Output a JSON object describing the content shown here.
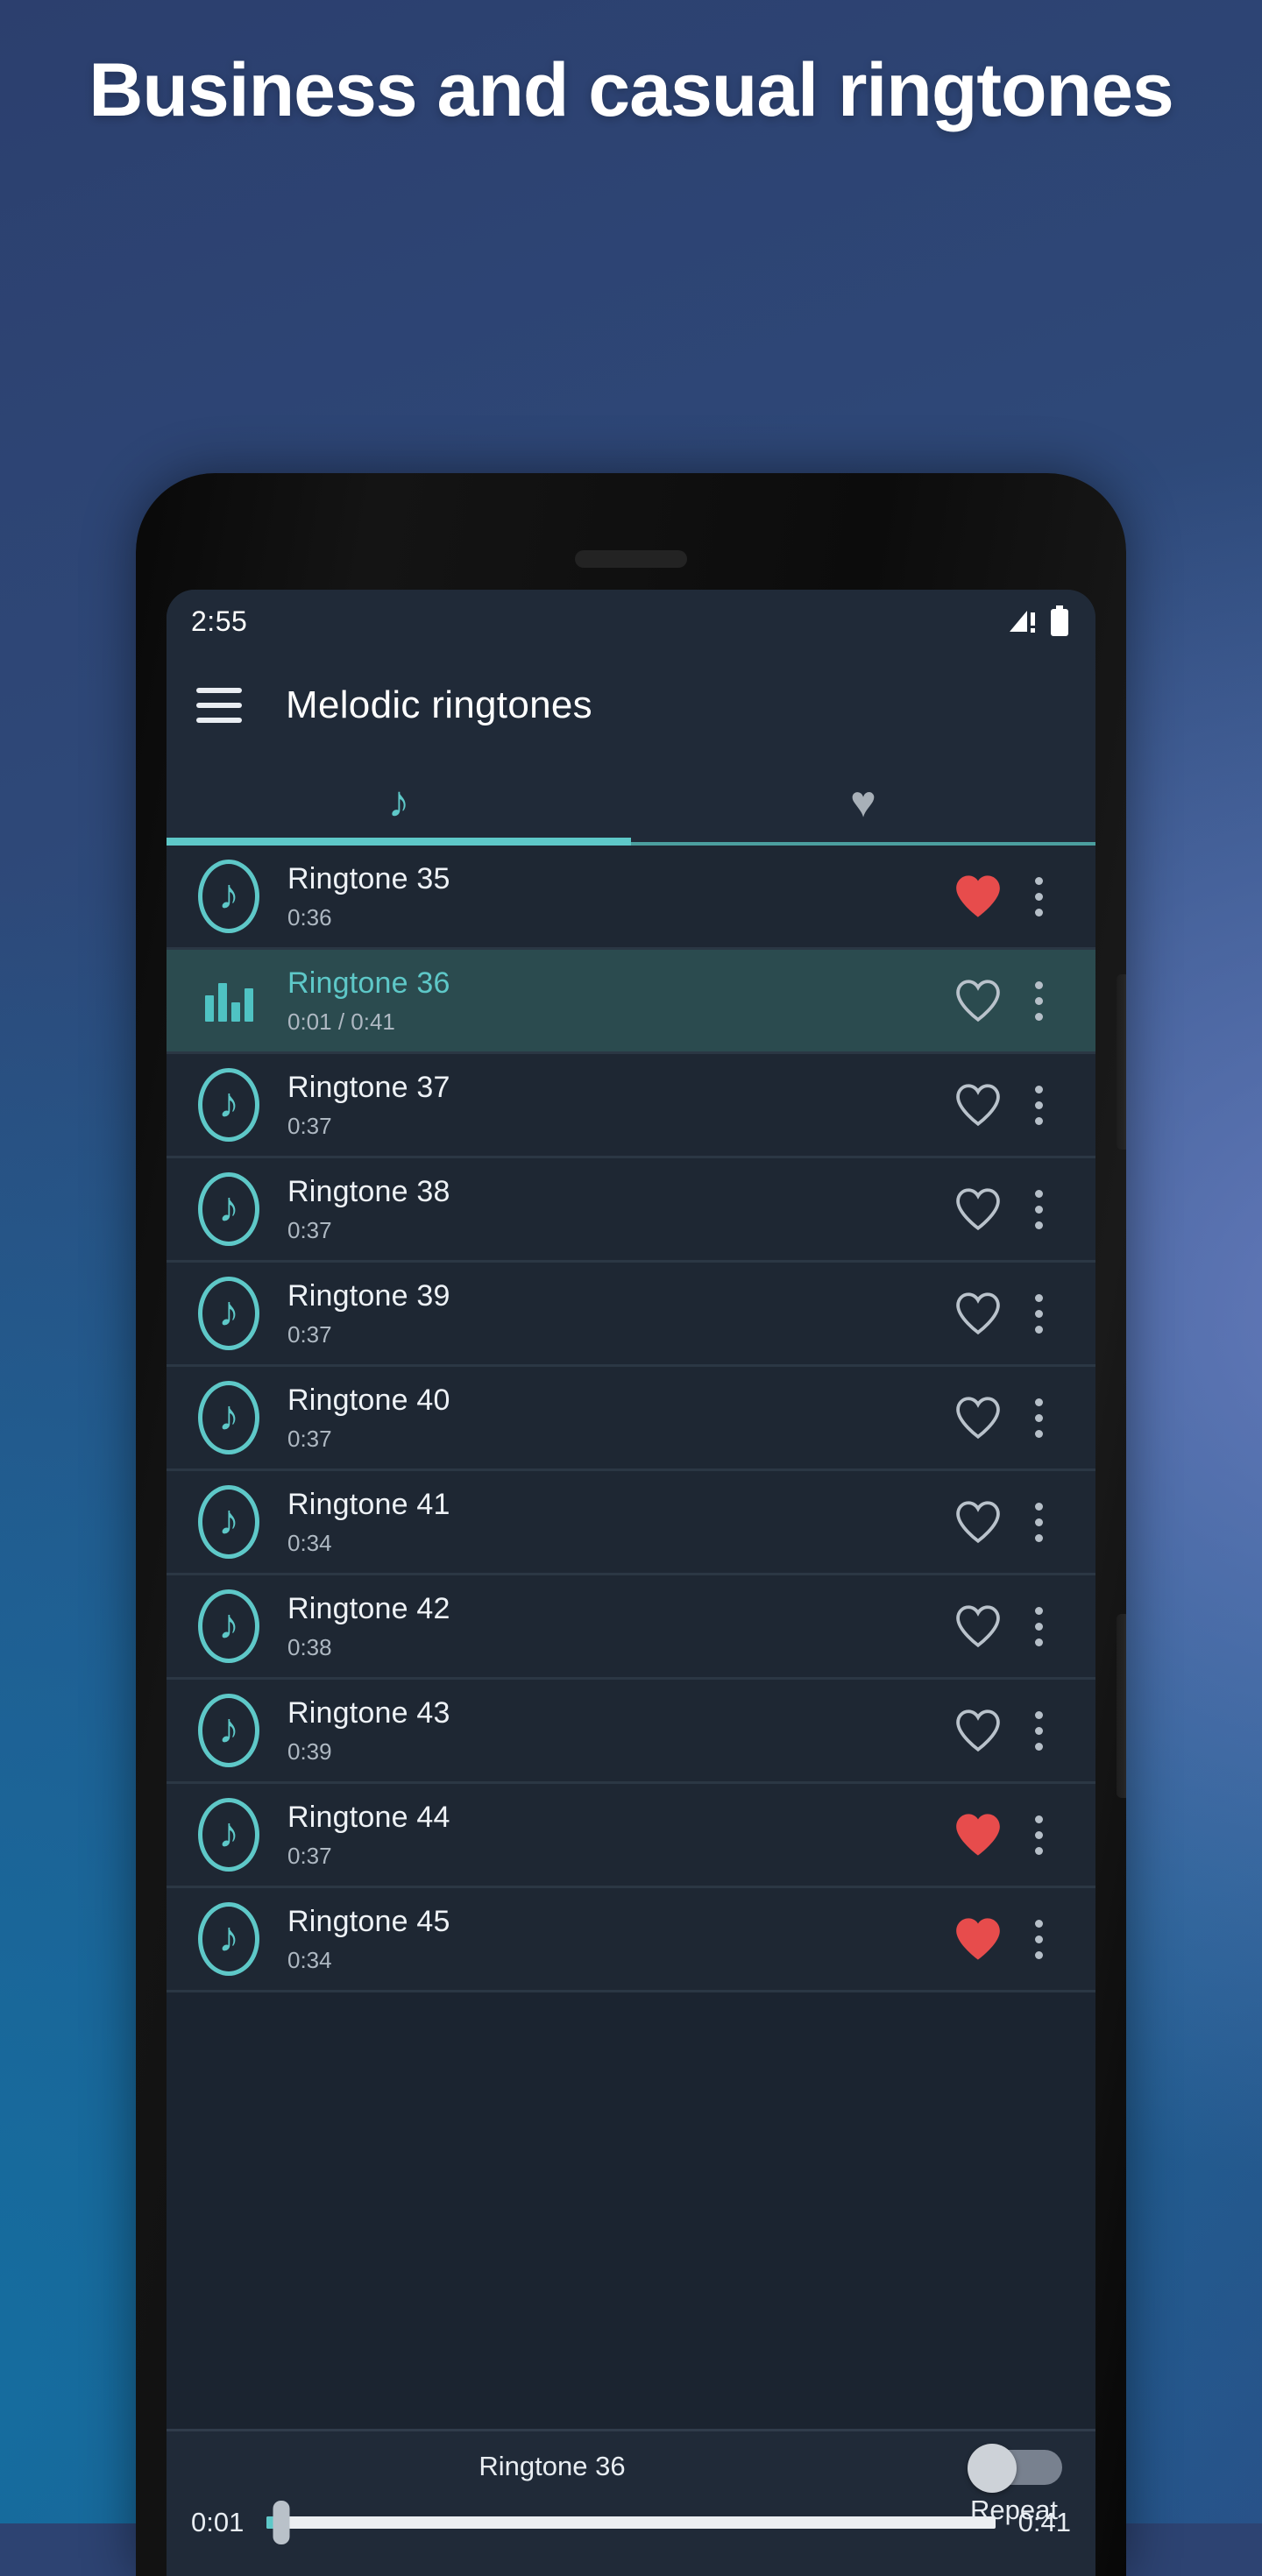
{
  "promo": {
    "headline": "Business and casual ringtones"
  },
  "phone": {
    "statusbar": {
      "clock": "2:55",
      "signal_icon": "signal-warning-icon",
      "battery_icon": "battery-full-icon"
    },
    "appbar": {
      "menu_icon": "hamburger-menu-icon",
      "title": "Melodic ringtones"
    },
    "tabs": [
      {
        "id": "all",
        "icon": "music-note-icon",
        "glyph": "♪",
        "active": true
      },
      {
        "id": "favorites",
        "icon": "heart-filled-icon",
        "glyph": "♥",
        "active": false
      }
    ],
    "accent_color": "#5ec8c8",
    "favorite_color": "#e74c4c",
    "list": [
      {
        "title": "Ringtone 35",
        "duration": "0:36",
        "favorite": true,
        "playing": false
      },
      {
        "title": "Ringtone 36",
        "duration": "0:01 / 0:41",
        "favorite": false,
        "playing": true
      },
      {
        "title": "Ringtone 37",
        "duration": "0:37",
        "favorite": false,
        "playing": false
      },
      {
        "title": "Ringtone 38",
        "duration": "0:37",
        "favorite": false,
        "playing": false
      },
      {
        "title": "Ringtone 39",
        "duration": "0:37",
        "favorite": false,
        "playing": false
      },
      {
        "title": "Ringtone 40",
        "duration": "0:37",
        "favorite": false,
        "playing": false
      },
      {
        "title": "Ringtone 41",
        "duration": "0:34",
        "favorite": false,
        "playing": false
      },
      {
        "title": "Ringtone 42",
        "duration": "0:38",
        "favorite": false,
        "playing": false
      },
      {
        "title": "Ringtone 43",
        "duration": "0:39",
        "favorite": false,
        "playing": false
      },
      {
        "title": "Ringtone 44",
        "duration": "0:37",
        "favorite": true,
        "playing": false
      },
      {
        "title": "Ringtone 45",
        "duration": "0:34",
        "favorite": true,
        "playing": false
      }
    ],
    "player": {
      "title": "Ringtone 36",
      "current_time": "0:01",
      "total_time": "0:41",
      "progress_percent": 2,
      "repeat_label": "Repeat",
      "repeat_on": false
    }
  }
}
